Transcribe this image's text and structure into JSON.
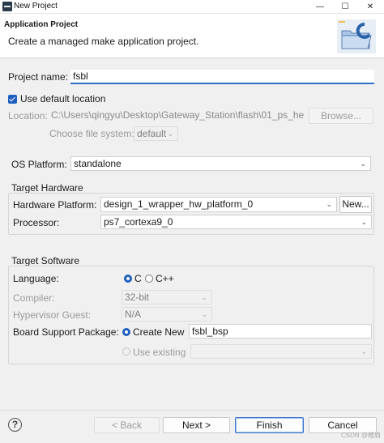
{
  "window": {
    "title": "New Project",
    "minimize": "—",
    "maximize": "☐",
    "close": "✕"
  },
  "header": {
    "title": "Application Project",
    "description": "Create a managed make application project."
  },
  "project_name": {
    "label": "Project name:",
    "value": "fsbl"
  },
  "location": {
    "use_default_label": "Use default location",
    "use_default_checked": true,
    "label": "Location:",
    "value": "C:\\Users\\qingyu\\Desktop\\Gateway_Station\\flash\\01_ps_he",
    "browse_label": "Browse...",
    "file_system_label": "Choose file system:",
    "file_system_value": "default"
  },
  "os_platform": {
    "label": "OS Platform:",
    "value": "standalone"
  },
  "target_hardware": {
    "title": "Target Hardware",
    "hw_platform_label": "Hardware Platform:",
    "hw_platform_value": "design_1_wrapper_hw_platform_0",
    "new_button": "New...",
    "processor_label": "Processor:",
    "processor_value": "ps7_cortexa9_0"
  },
  "target_software": {
    "title": "Target Software",
    "language_label": "Language:",
    "language_options": [
      "C",
      "C++"
    ],
    "language_selected": "C",
    "compiler_label": "Compiler:",
    "compiler_value": "32-bit",
    "hypervisor_label": "Hypervisor Guest:",
    "hypervisor_value": "N/A",
    "bsp_label": "Board Support Package:",
    "create_new_label": "Create New",
    "bsp_name": "fsbl_bsp",
    "use_existing_label": "Use existing"
  },
  "footer": {
    "help": "?",
    "back": "< Back",
    "next": "Next >",
    "finish": "Finish",
    "cancel": "Cancel"
  },
  "watermark": "CSDN @楂肩",
  "colors": {
    "accent": "#1f5fbf",
    "focus_underline": "#2f6fc7",
    "background": "#f0f0f0"
  }
}
